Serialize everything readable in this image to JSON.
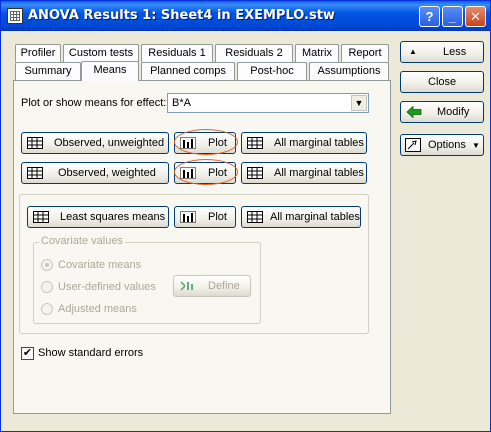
{
  "window": {
    "title": "ANOVA Results 1: Sheet4 in EXEMPLO.stw",
    "help_glyph": "?",
    "minimize_glyph": "_",
    "close_glyph": "✕"
  },
  "tabs_row1": [
    "Profiler",
    "Custom tests",
    "Residuals 1",
    "Residuals 2",
    "Matrix",
    "Report"
  ],
  "tabs_row2": [
    "Summary",
    "Means",
    "Planned comps",
    "Post-hoc",
    "Assumptions"
  ],
  "active_tab": "Means",
  "effect": {
    "label": "Plot or show means for effect:",
    "value": "B*A"
  },
  "observed_unweighted": {
    "label": "Observed, unweighted",
    "plot": "Plot",
    "marginal": "All marginal tables"
  },
  "observed_weighted": {
    "label": "Observed, weighted",
    "plot": "Plot",
    "marginal": "All marginal tables"
  },
  "least_squares": {
    "label": "Least squares means",
    "plot": "Plot",
    "marginal": "All marginal tables"
  },
  "covariate": {
    "group_label": "Covariate values",
    "options": [
      "Covariate means",
      "User-defined values",
      "Adjusted means"
    ],
    "selected": "Covariate means",
    "define_label": "Define"
  },
  "show_std_errors": {
    "label": "Show standard errors",
    "checked": true,
    "check_glyph": "✔"
  },
  "side": {
    "less": "Less",
    "close": "Close",
    "modify": "Modify",
    "options": "Options",
    "less_glyph": "▲",
    "dropdown_glyph": "▼"
  },
  "colors": {
    "titlebar": "#0054e3",
    "annotation_circle": "#e0632a",
    "modify_arrow": "#1f9c1f"
  }
}
